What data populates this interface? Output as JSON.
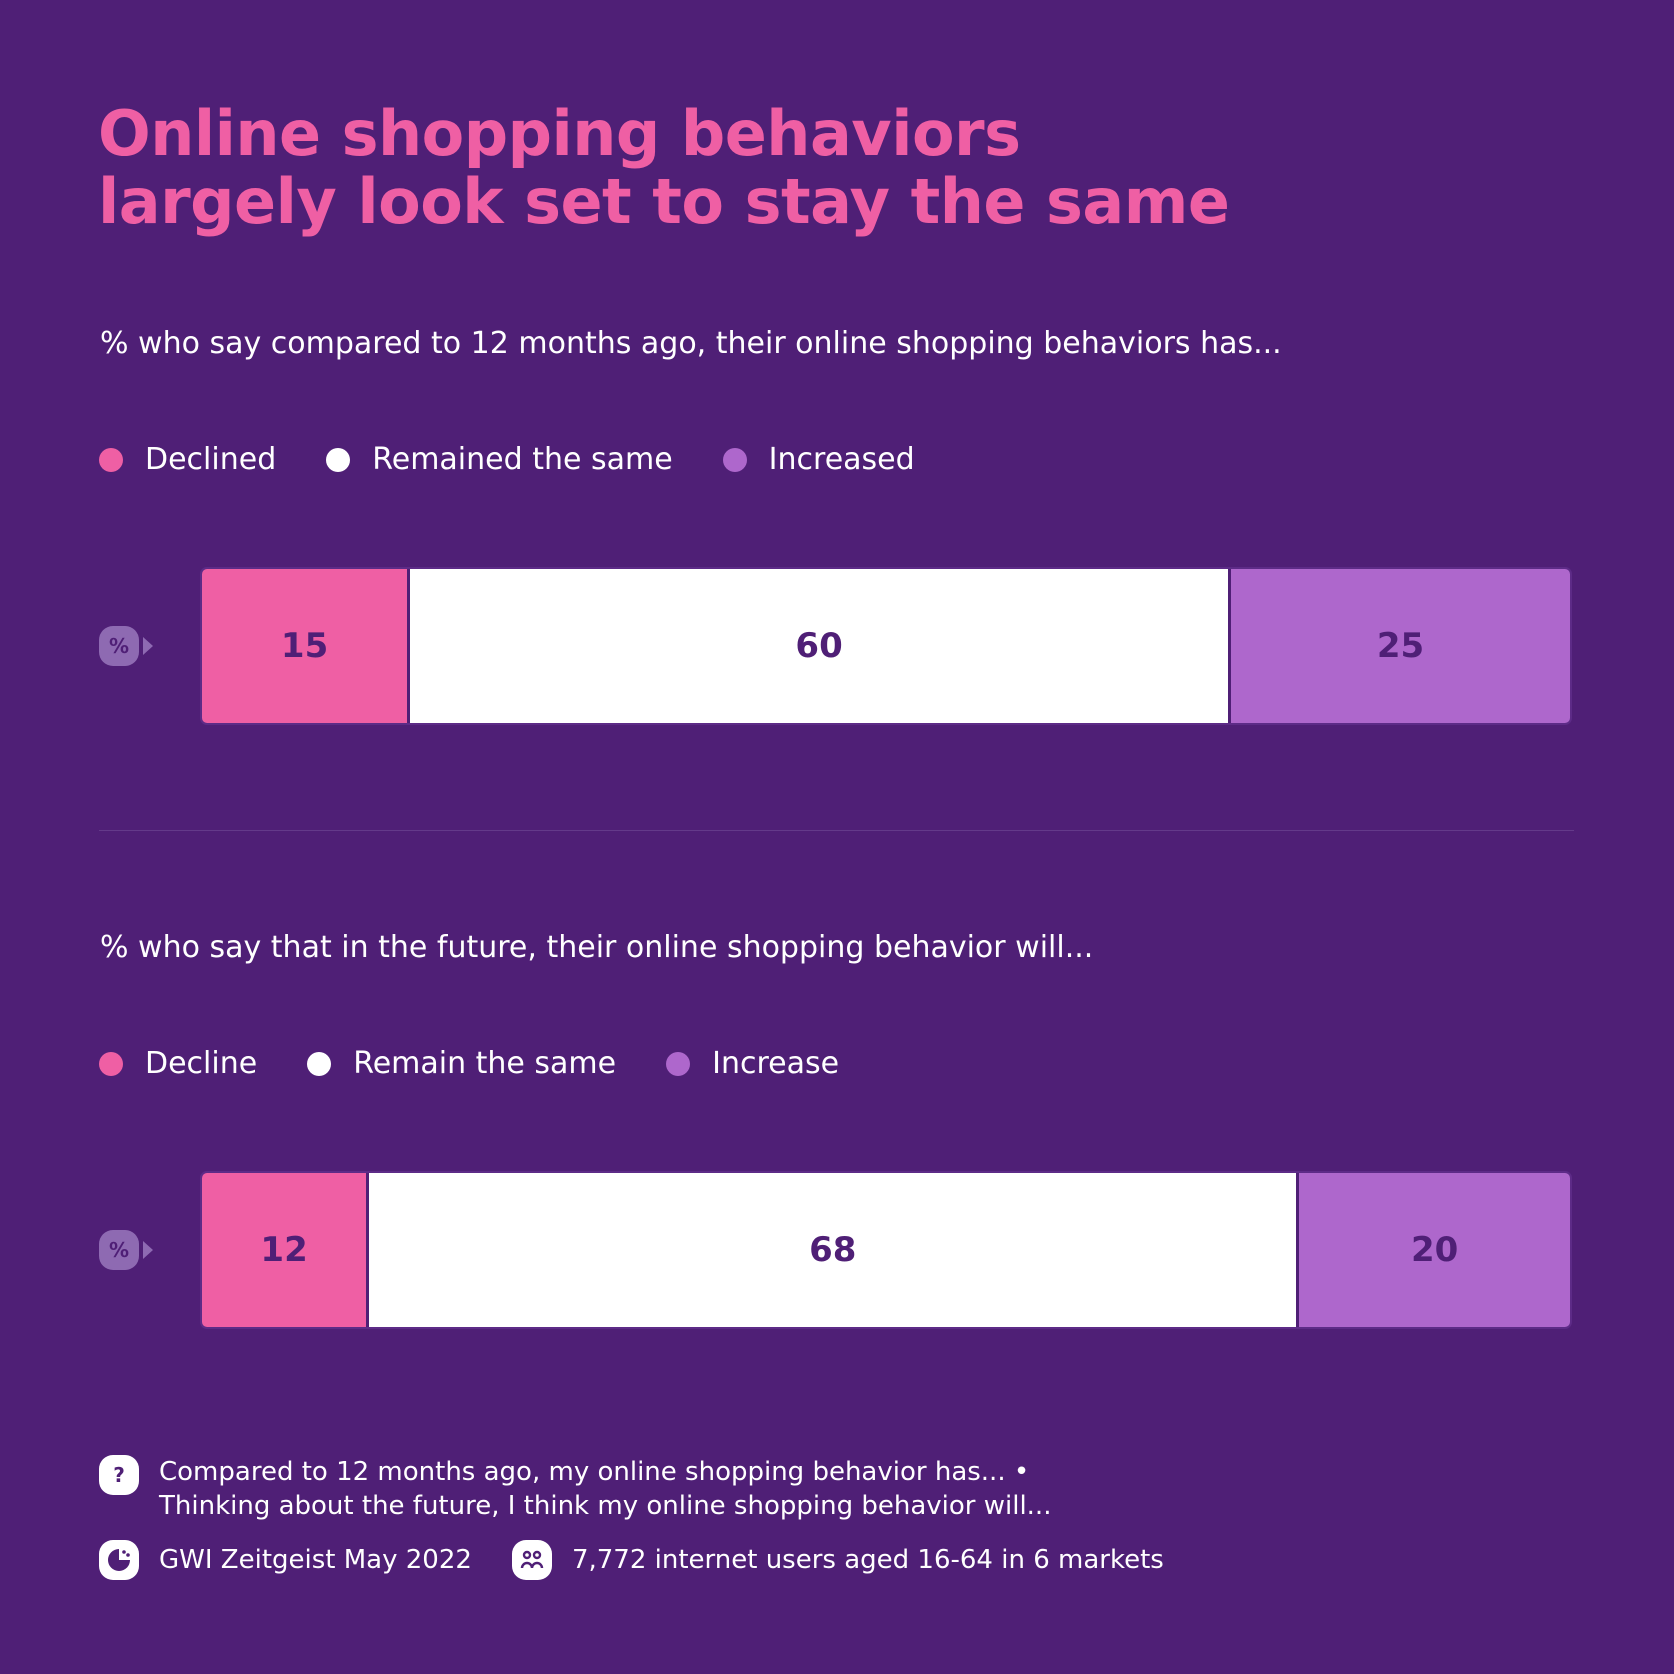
{
  "title_line1": "Online shopping behaviors",
  "title_line2": "largely look set to stay the same",
  "colors": {
    "background": "#4f1f76",
    "pink": "#ef5fa4",
    "white": "#ffffff",
    "purple": "#ae67cc",
    "text_dark": "#4f1f76"
  },
  "chart_data": [
    {
      "type": "bar",
      "stacked": true,
      "orientation": "horizontal",
      "title": "% who say compared to 12 months ago, their online shopping behaviors has...",
      "categories": [
        "%"
      ],
      "series": [
        {
          "name": "Declined",
          "values": [
            15
          ],
          "color": "#ef5fa4"
        },
        {
          "name": "Remained the same",
          "values": [
            60
          ],
          "color": "#ffffff"
        },
        {
          "name": "Increased",
          "values": [
            25
          ],
          "color": "#ae67cc"
        }
      ],
      "legend": "top-left",
      "xlim": [
        0,
        100
      ]
    },
    {
      "type": "bar",
      "stacked": true,
      "orientation": "horizontal",
      "title": "% who say that in the future, their online shopping behavior will...",
      "categories": [
        "%"
      ],
      "series": [
        {
          "name": "Decline",
          "values": [
            12
          ],
          "color": "#ef5fa4"
        },
        {
          "name": "Remain the same",
          "values": [
            68
          ],
          "color": "#ffffff"
        },
        {
          "name": "Increase",
          "values": [
            20
          ],
          "color": "#ae67cc"
        }
      ],
      "legend": "top-left",
      "xlim": [
        0,
        100
      ]
    }
  ],
  "unit_badge": "%",
  "footer": {
    "question_icon": "question-icon",
    "question_line1": "Compared to 12 months ago, my online shopping behavior has... •",
    "question_line2": "Thinking about the future, I think my online shopping behavior will...",
    "source_icon": "gwi-logo-icon",
    "source": "GWI Zeitgeist May 2022",
    "audience_icon": "people-icon",
    "audience": "7,772 internet users aged 16-64 in 6 markets"
  }
}
